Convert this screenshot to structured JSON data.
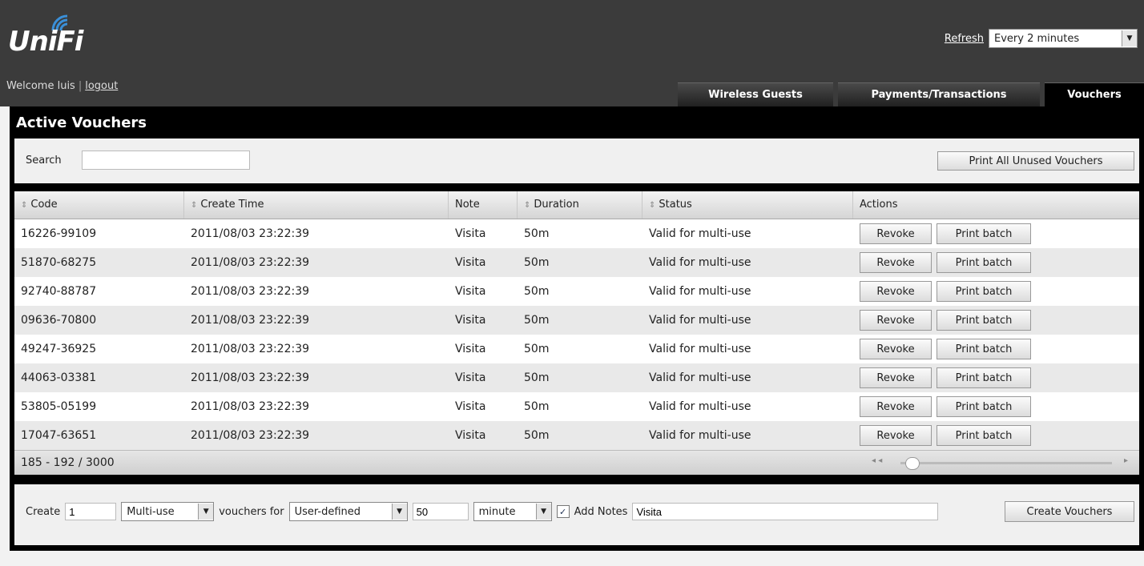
{
  "header": {
    "logo_text": "UniFi",
    "welcome_text": "Welcome luis",
    "logout_label": "logout",
    "refresh_label": "Refresh",
    "refresh_interval": "Every 2 minutes"
  },
  "tabs": [
    {
      "label": "Wireless Guests"
    },
    {
      "label": "Payments/Transactions"
    },
    {
      "label": "Vouchers"
    }
  ],
  "panel": {
    "title": "Active Vouchers",
    "search_label": "Search",
    "search_value": "",
    "print_all_label": "Print All Unused Vouchers"
  },
  "table": {
    "columns": [
      "Code",
      "Create Time",
      "Note",
      "Duration",
      "Status",
      "Actions"
    ],
    "sortable": [
      true,
      true,
      false,
      true,
      true,
      false
    ],
    "rows": [
      {
        "code": "16226-99109",
        "time": "2011/08/03  23:22:39",
        "note": "Visita",
        "duration": "50m",
        "status": "Valid for multi-use"
      },
      {
        "code": "51870-68275",
        "time": "2011/08/03  23:22:39",
        "note": "Visita",
        "duration": "50m",
        "status": "Valid for multi-use"
      },
      {
        "code": "92740-88787",
        "time": "2011/08/03  23:22:39",
        "note": "Visita",
        "duration": "50m",
        "status": "Valid for multi-use"
      },
      {
        "code": "09636-70800",
        "time": "2011/08/03  23:22:39",
        "note": "Visita",
        "duration": "50m",
        "status": "Valid for multi-use"
      },
      {
        "code": "49247-36925",
        "time": "2011/08/03  23:22:39",
        "note": "Visita",
        "duration": "50m",
        "status": "Valid for multi-use"
      },
      {
        "code": "44063-03381",
        "time": "2011/08/03  23:22:39",
        "note": "Visita",
        "duration": "50m",
        "status": "Valid for multi-use"
      },
      {
        "code": "53805-05199",
        "time": "2011/08/03  23:22:39",
        "note": "Visita",
        "duration": "50m",
        "status": "Valid for multi-use"
      },
      {
        "code": "17047-63651",
        "time": "2011/08/03  23:22:39",
        "note": "Visita",
        "duration": "50m",
        "status": "Valid for multi-use"
      }
    ],
    "revoke_label": "Revoke",
    "print_batch_label": "Print batch",
    "pagination": "185 - 192 / 3000"
  },
  "create": {
    "create_label": "Create",
    "count_value": "1",
    "type_value": "Multi-use",
    "vouchers_for_label": "vouchers for",
    "quota_value": "User-defined",
    "duration_value": "50",
    "unit_value": "minute",
    "add_notes_checked": true,
    "add_notes_label": "Add Notes",
    "notes_value": "Visita",
    "create_button_label": "Create Vouchers"
  },
  "icons": {
    "logo": "wifi-arc-icon",
    "sort": "sort-arrows-icon",
    "dropdown": "chevron-down-icon",
    "checkbox": "checkmark-icon"
  },
  "colors": {
    "topbar": "#3b3b3b",
    "panel": "#000000",
    "logo_arc": "#3a8fd8"
  }
}
